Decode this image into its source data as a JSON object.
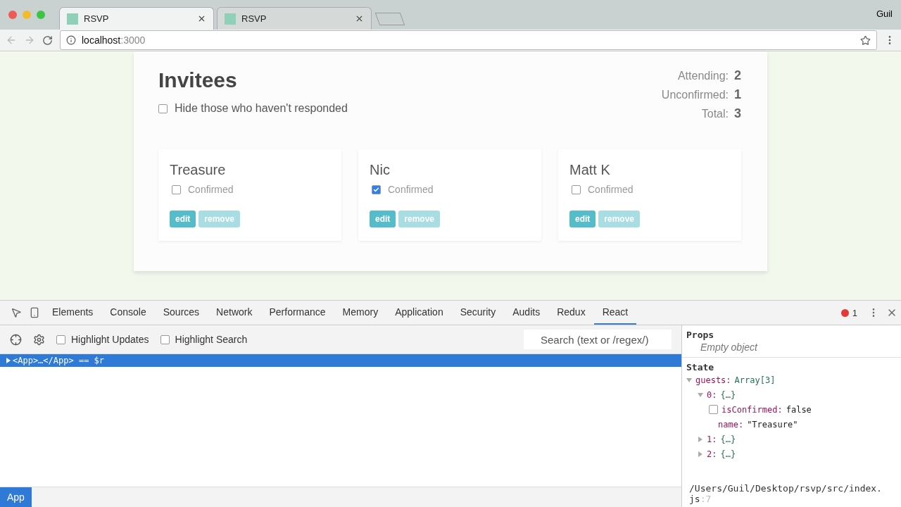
{
  "browser": {
    "tabs": [
      {
        "title": "RSVP",
        "selected": true
      },
      {
        "title": "RSVP",
        "selected": false
      }
    ],
    "profile": "Guil",
    "url": {
      "host": "localhost",
      "port": ":3000"
    }
  },
  "page": {
    "heading": "Invitees",
    "hide_filter": {
      "label": "Hide those who haven't responded",
      "checked": false
    },
    "stats": [
      {
        "label": "Attending:",
        "value": "2"
      },
      {
        "label": "Unconfirmed:",
        "value": "1"
      },
      {
        "label": "Total:",
        "value": "3"
      }
    ],
    "guests": [
      {
        "name": "Treasure",
        "confirm_label": "Confirmed",
        "confirmed": false,
        "edit": "edit",
        "remove": "remove"
      },
      {
        "name": "Nic",
        "confirm_label": "Confirmed",
        "confirmed": true,
        "edit": "edit",
        "remove": "remove"
      },
      {
        "name": "Matt K",
        "confirm_label": "Confirmed",
        "confirmed": false,
        "edit": "edit",
        "remove": "remove"
      }
    ]
  },
  "devtools": {
    "panels": [
      {
        "label": "Elements",
        "selected": false
      },
      {
        "label": "Console",
        "selected": false
      },
      {
        "label": "Sources",
        "selected": false
      },
      {
        "label": "Network",
        "selected": false
      },
      {
        "label": "Performance",
        "selected": false
      },
      {
        "label": "Memory",
        "selected": false
      },
      {
        "label": "Application",
        "selected": false
      },
      {
        "label": "Security",
        "selected": false
      },
      {
        "label": "Audits",
        "selected": false
      },
      {
        "label": "Redux",
        "selected": false
      },
      {
        "label": "React",
        "selected": true
      }
    ],
    "error_count": "1",
    "options": [
      {
        "label": "Highlight Updates",
        "checked": false
      },
      {
        "label": "Highlight Search",
        "checked": false
      }
    ],
    "search": {
      "placeholder": "Search (text or /regex/)"
    },
    "tree": [
      {
        "text": "<App>…</App> == $r",
        "selected": true
      }
    ],
    "props": {
      "title": "Props",
      "empty": "Empty object"
    },
    "state": {
      "title": "State",
      "items": [
        {
          "key": "guests:",
          "value": "Array[3]",
          "expanded": true,
          "children": [
            {
              "key": "0:",
              "value": "{…}",
              "expanded": true,
              "children": [
                {
                  "key": "isConfirmed:",
                  "value": "false",
                  "kind": "checkbox",
                  "checked": false
                },
                {
                  "key": "name:",
                  "value": "\"Treasure\"",
                  "kind": "plain"
                }
              ]
            },
            {
              "key": "1:",
              "value": "{…}",
              "expanded": false
            },
            {
              "key": "2:",
              "value": "{…}",
              "expanded": false
            }
          ]
        }
      ]
    },
    "source": {
      "path": "/Users/Guil/Desktop/rsvp/src/index.js",
      "line": ":7"
    },
    "breadcrumbs": [
      {
        "label": "App",
        "selected": true
      }
    ]
  }
}
